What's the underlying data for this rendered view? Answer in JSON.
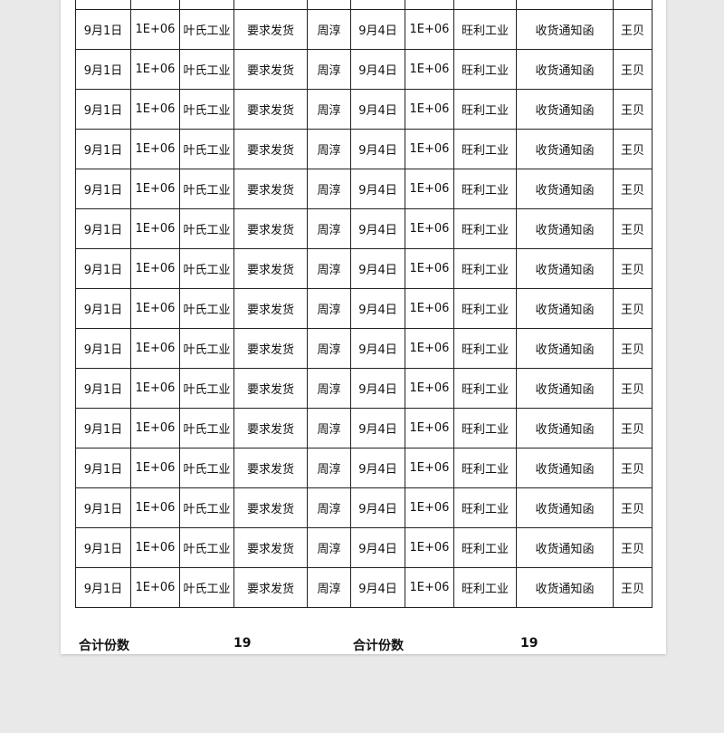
{
  "columns": [
    "date_sent",
    "number_sent",
    "company_sent",
    "subject_sent",
    "handler_sent",
    "date_recv",
    "number_recv",
    "company_recv",
    "subject_recv",
    "handler_recv"
  ],
  "rows": [
    [
      "9月1日",
      "1E+06",
      "叶氏工业",
      "要求发货",
      "周淳",
      "9月4日",
      "1E+06",
      "旺利工业",
      "收货通知函",
      "王贝"
    ],
    [
      "9月1日",
      "1E+06",
      "叶氏工业",
      "要求发货",
      "周淳",
      "9月4日",
      "1E+06",
      "旺利工业",
      "收货通知函",
      "王贝"
    ],
    [
      "9月1日",
      "1E+06",
      "叶氏工业",
      "要求发货",
      "周淳",
      "9月4日",
      "1E+06",
      "旺利工业",
      "收货通知函",
      "王贝"
    ],
    [
      "9月1日",
      "1E+06",
      "叶氏工业",
      "要求发货",
      "周淳",
      "9月4日",
      "1E+06",
      "旺利工业",
      "收货通知函",
      "王贝"
    ],
    [
      "9月1日",
      "1E+06",
      "叶氏工业",
      "要求发货",
      "周淳",
      "9月4日",
      "1E+06",
      "旺利工业",
      "收货通知函",
      "王贝"
    ],
    [
      "9月1日",
      "1E+06",
      "叶氏工业",
      "要求发货",
      "周淳",
      "9月4日",
      "1E+06",
      "旺利工业",
      "收货通知函",
      "王贝"
    ],
    [
      "9月1日",
      "1E+06",
      "叶氏工业",
      "要求发货",
      "周淳",
      "9月4日",
      "1E+06",
      "旺利工业",
      "收货通知函",
      "王贝"
    ],
    [
      "9月1日",
      "1E+06",
      "叶氏工业",
      "要求发货",
      "周淳",
      "9月4日",
      "1E+06",
      "旺利工业",
      "收货通知函",
      "王贝"
    ],
    [
      "9月1日",
      "1E+06",
      "叶氏工业",
      "要求发货",
      "周淳",
      "9月4日",
      "1E+06",
      "旺利工业",
      "收货通知函",
      "王贝"
    ],
    [
      "9月1日",
      "1E+06",
      "叶氏工业",
      "要求发货",
      "周淳",
      "9月4日",
      "1E+06",
      "旺利工业",
      "收货通知函",
      "王贝"
    ],
    [
      "9月1日",
      "1E+06",
      "叶氏工业",
      "要求发货",
      "周淳",
      "9月4日",
      "1E+06",
      "旺利工业",
      "收货通知函",
      "王贝"
    ],
    [
      "9月1日",
      "1E+06",
      "叶氏工业",
      "要求发货",
      "周淳",
      "9月4日",
      "1E+06",
      "旺利工业",
      "收货通知函",
      "王贝"
    ],
    [
      "9月1日",
      "1E+06",
      "叶氏工业",
      "要求发货",
      "周淳",
      "9月4日",
      "1E+06",
      "旺利工业",
      "收货通知函",
      "王贝"
    ],
    [
      "9月1日",
      "1E+06",
      "叶氏工业",
      "要求发货",
      "周淳",
      "9月4日",
      "1E+06",
      "旺利工业",
      "收货通知函",
      "王贝"
    ],
    [
      "9月1日",
      "1E+06",
      "叶氏工业",
      "要求发货",
      "周淳",
      "9月4日",
      "1E+06",
      "旺利工业",
      "收货通知函",
      "王贝"
    ]
  ],
  "footer": {
    "left_label": "合计份数",
    "left_count": "19",
    "right_label": "合计份数",
    "right_count": "19"
  }
}
